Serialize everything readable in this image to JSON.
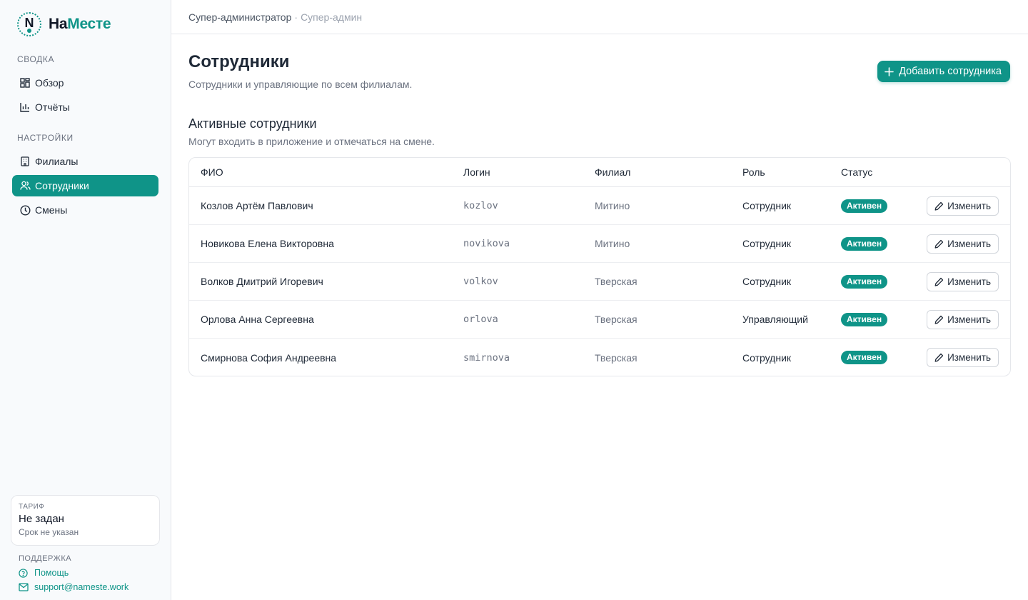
{
  "brand": {
    "name_part1": "На",
    "name_part2": "Месте",
    "mark_letter": "N"
  },
  "colors": {
    "accent": "#0f9488",
    "sidebar_bg": "#f8fafc",
    "border": "#e5e7eb",
    "muted": "#6b7280"
  },
  "sidebar": {
    "sections": [
      {
        "label": "Сводка",
        "items": [
          {
            "label": "Обзор",
            "icon": "dashboard-icon"
          },
          {
            "label": "Отчёты",
            "icon": "bar-chart-icon"
          }
        ]
      },
      {
        "label": "Настройки",
        "items": [
          {
            "label": "Филиалы",
            "icon": "building-icon"
          },
          {
            "label": "Сотрудники",
            "icon": "users-icon",
            "active": true
          },
          {
            "label": "Смены",
            "icon": "clock-icon"
          }
        ]
      }
    ],
    "plan": {
      "label": "Тариф",
      "value": "Не задан",
      "sub": "Срок не указан"
    },
    "support": {
      "label": "Поддержка",
      "help": "Помощь",
      "email": "support@nameste.work"
    }
  },
  "breadcrumb": {
    "role": "Супер-администратор",
    "separator": "·",
    "sub": "Супер-админ"
  },
  "page": {
    "title": "Сотрудники",
    "subtitle": "Сотрудники и управляющие по всем филиалам.",
    "add_button": "Добавить сотрудника"
  },
  "section": {
    "title": "Активные сотрудники",
    "subtitle": "Могут входить в приложение и отмечаться на смене."
  },
  "table": {
    "columns": {
      "fio": "ФИО",
      "login": "Логин",
      "branch": "Филиал",
      "role": "Роль",
      "status": "Статус"
    },
    "edit_label": "Изменить",
    "rows": [
      {
        "fio": "Козлов Артём Павлович",
        "login": "kozlov",
        "branch": "Митино",
        "role": "Сотрудник",
        "status": "Активен"
      },
      {
        "fio": "Новикова Елена Викторовна",
        "login": "novikova",
        "branch": "Митино",
        "role": "Сотрудник",
        "status": "Активен"
      },
      {
        "fio": "Волков Дмитрий Игоревич",
        "login": "volkov",
        "branch": "Тверская",
        "role": "Сотрудник",
        "status": "Активен"
      },
      {
        "fio": "Орлова Анна Сергеевна",
        "login": "orlova",
        "branch": "Тверская",
        "role": "Управляющий",
        "status": "Активен"
      },
      {
        "fio": "Смирнова София Андреевна",
        "login": "smirnova",
        "branch": "Тверская",
        "role": "Сотрудник",
        "status": "Активен"
      }
    ]
  }
}
